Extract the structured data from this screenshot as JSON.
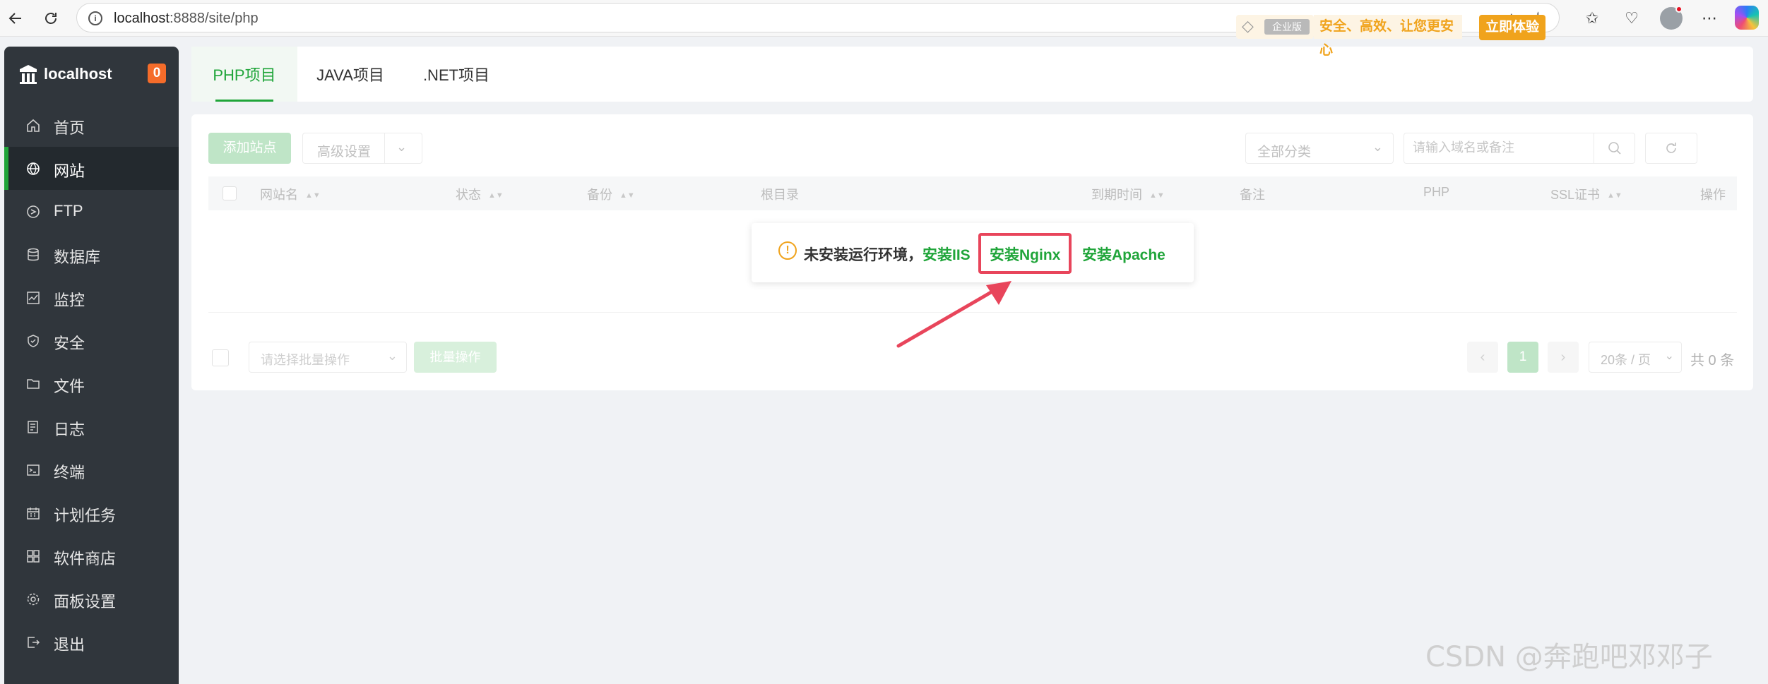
{
  "browser": {
    "url_host": "localhost",
    "url_rest": ":8888/site/php"
  },
  "sidebar": {
    "brand": "localhost",
    "badge": "0",
    "items": [
      {
        "label": "首页",
        "icon": "home-icon"
      },
      {
        "label": "网站",
        "icon": "globe-icon",
        "active": true
      },
      {
        "label": "FTP",
        "icon": "ftp-icon"
      },
      {
        "label": "数据库",
        "icon": "database-icon"
      },
      {
        "label": "监控",
        "icon": "monitor-icon"
      },
      {
        "label": "安全",
        "icon": "shield-icon"
      },
      {
        "label": "文件",
        "icon": "folder-icon"
      },
      {
        "label": "日志",
        "icon": "log-icon"
      },
      {
        "label": "终端",
        "icon": "terminal-icon"
      },
      {
        "label": "计划任务",
        "icon": "calendar-icon"
      },
      {
        "label": "软件商店",
        "icon": "grid-icon"
      },
      {
        "label": "面板设置",
        "icon": "gear-icon"
      },
      {
        "label": "退出",
        "icon": "logout-icon"
      }
    ]
  },
  "tabs": [
    {
      "label": "PHP项目",
      "active": true
    },
    {
      "label": "JAVA项目"
    },
    {
      "label": ".NET项目"
    }
  ],
  "promo": {
    "edition": "企业版",
    "slogan": "安全、高效、让您更安心",
    "button": "立即体验"
  },
  "toolbar": {
    "add_site": "添加站点",
    "advanced": "高级设置",
    "category": "全部分类",
    "search_placeholder": "请输入域名或备注"
  },
  "table": {
    "columns": [
      "网站名",
      "状态",
      "备份",
      "根目录",
      "到期时间",
      "备注",
      "PHP",
      "SSL证书",
      "操作"
    ]
  },
  "notice": {
    "text": "未安装运行环境，",
    "links": [
      "安装IIS",
      "安装Nginx",
      "安装Apache"
    ]
  },
  "footer": {
    "batch_placeholder": "请选择批量操作",
    "batch_button": "批量操作",
    "current_page": "1",
    "page_size": "20条 / 页",
    "total": "共 0 条"
  },
  "watermark": "CSDN @奔跑吧邓邓子",
  "colors": {
    "primary": "#20a53a",
    "sidebar_bg": "#30363c",
    "promo": "#f0a31c",
    "highlight": "#e8455b"
  }
}
